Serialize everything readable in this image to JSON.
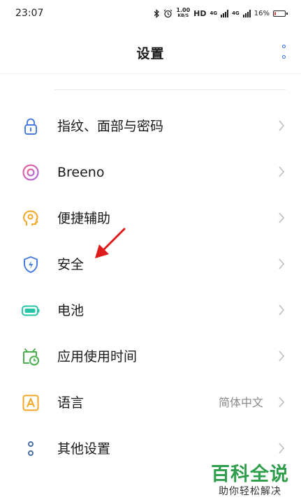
{
  "status_bar": {
    "time": "23:07",
    "speed_value": "1.00",
    "speed_unit": "KB/S",
    "hd_label": "HD",
    "sim1_tag": "4G",
    "sim2_tag": "4G",
    "battery": "16%",
    "battery_level": 0.16,
    "battery_color": "#e53935"
  },
  "header": {
    "title": "设置",
    "accent_color": "#2f6ee8"
  },
  "settings": {
    "items": [
      {
        "label": "指纹、面部与密码",
        "icon": "lock-icon",
        "value": ""
      },
      {
        "label": "Breeno",
        "icon": "breeno-icon",
        "value": ""
      },
      {
        "label": "便捷辅助",
        "icon": "head-gear-icon",
        "value": ""
      },
      {
        "label": "安全",
        "icon": "shield-icon",
        "value": ""
      },
      {
        "label": "电池",
        "icon": "battery-icon",
        "value": ""
      },
      {
        "label": "应用使用时间",
        "icon": "app-usage-clock-icon",
        "value": ""
      },
      {
        "label": "语言",
        "icon": "language-a-icon",
        "value": "简体中文"
      },
      {
        "label": "其他设置",
        "icon": "other-settings-icon",
        "value": ""
      }
    ]
  },
  "watermark": {
    "title": "百科全说",
    "subtitle": "助你轻松解决",
    "color": "#2e9e4a"
  },
  "annotation": {
    "icon": "red-arrow-icon",
    "color": "#e01b1b"
  }
}
